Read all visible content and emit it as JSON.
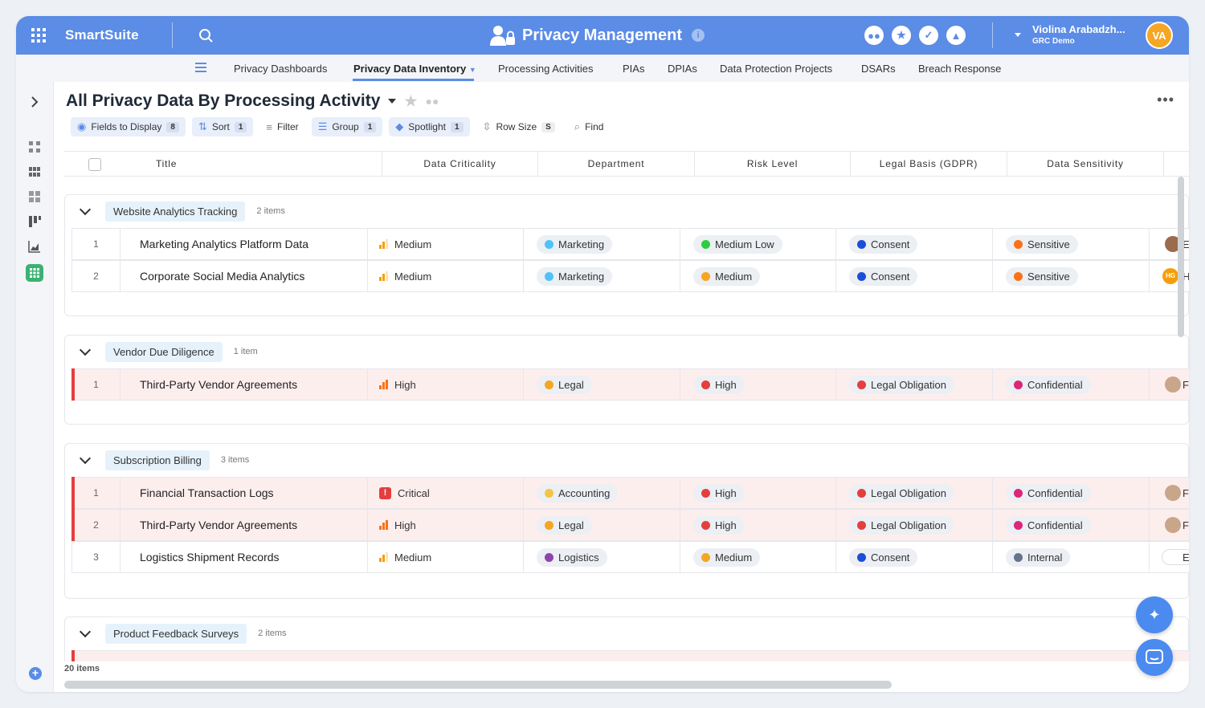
{
  "brand": "SmartSuite",
  "app_title": "Privacy Management",
  "user": {
    "name": "Violina Arabadzh...",
    "workspace": "GRC Demo",
    "initials": "VA"
  },
  "nav": {
    "items": [
      "Privacy Dashboards",
      "Privacy Data Inventory",
      "Processing Activities",
      "PIAs",
      "DPIAs",
      "Data Protection Projects",
      "DSARs",
      "Breach Response"
    ],
    "active": "Privacy Data Inventory"
  },
  "view": {
    "title": "All Privacy Data By Processing Activity"
  },
  "toolbar": {
    "fields_label": "Fields to Display",
    "fields_count": "8",
    "sort_label": "Sort",
    "sort_count": "1",
    "filter_label": "Filter",
    "group_label": "Group",
    "group_count": "1",
    "spotlight_label": "Spotlight",
    "spotlight_count": "1",
    "rowsize_label": "Row Size",
    "rowsize_value": "S",
    "find_label": "Find"
  },
  "columns": [
    "Title",
    "Data Criticality",
    "Department",
    "Risk Level",
    "Legal Basis (GDPR)",
    "Data Sensitivity"
  ],
  "colors": {
    "accent": "#5b8ce6",
    "marketing": "#4fc3f7",
    "legal": "#f5a623",
    "accounting": "#f5c542",
    "logistics": "#8e44ad",
    "medium_low": "#2ecc40",
    "medium": "#f5a623",
    "high": "#e53e3e",
    "consent": "#1d4ed8",
    "legal_obligation": "#e53e3e",
    "sensitive": "#f97316",
    "confidential": "#db2777",
    "internal": "#64748b"
  },
  "groups": [
    {
      "name": "Website Analytics Tracking",
      "count": "2 items",
      "rows": [
        {
          "num": "1",
          "title": "Marketing Analytics Platform Data",
          "criticality": "Medium",
          "department": "Marketing",
          "risk": "Medium Low",
          "legal": "Consent",
          "sensitivity": "Sensitive",
          "owner": "E"
        },
        {
          "num": "2",
          "title": "Corporate Social Media Analytics",
          "criticality": "Medium",
          "department": "Marketing",
          "risk": "Medium",
          "legal": "Consent",
          "sensitivity": "Sensitive",
          "owner_initials": "HG",
          "owner": "H"
        }
      ]
    },
    {
      "name": "Vendor Due Diligence",
      "count": "1 item",
      "rows": [
        {
          "num": "1",
          "title": "Third-Party Vendor Agreements",
          "criticality": "High",
          "department": "Legal",
          "risk": "High",
          "legal": "Legal Obligation",
          "sensitivity": "Confidential",
          "owner": "F"
        }
      ]
    },
    {
      "name": "Subscription Billing",
      "count": "3 items",
      "rows": [
        {
          "num": "1",
          "title": "Financial Transaction Logs",
          "criticality": "Critical",
          "department": "Accounting",
          "risk": "High",
          "legal": "Legal Obligation",
          "sensitivity": "Confidential",
          "owner": "F"
        },
        {
          "num": "2",
          "title": "Third-Party Vendor Agreements",
          "criticality": "High",
          "department": "Legal",
          "risk": "High",
          "legal": "Legal Obligation",
          "sensitivity": "Confidential",
          "owner": "F"
        },
        {
          "num": "3",
          "title": "Logistics Shipment Records",
          "criticality": "Medium",
          "department": "Logistics",
          "risk": "Medium",
          "legal": "Consent",
          "sensitivity": "Internal",
          "owner": "E"
        }
      ]
    },
    {
      "name": "Product Feedback Surveys",
      "count": "2 items"
    }
  ],
  "footer": {
    "total": "20 items"
  }
}
